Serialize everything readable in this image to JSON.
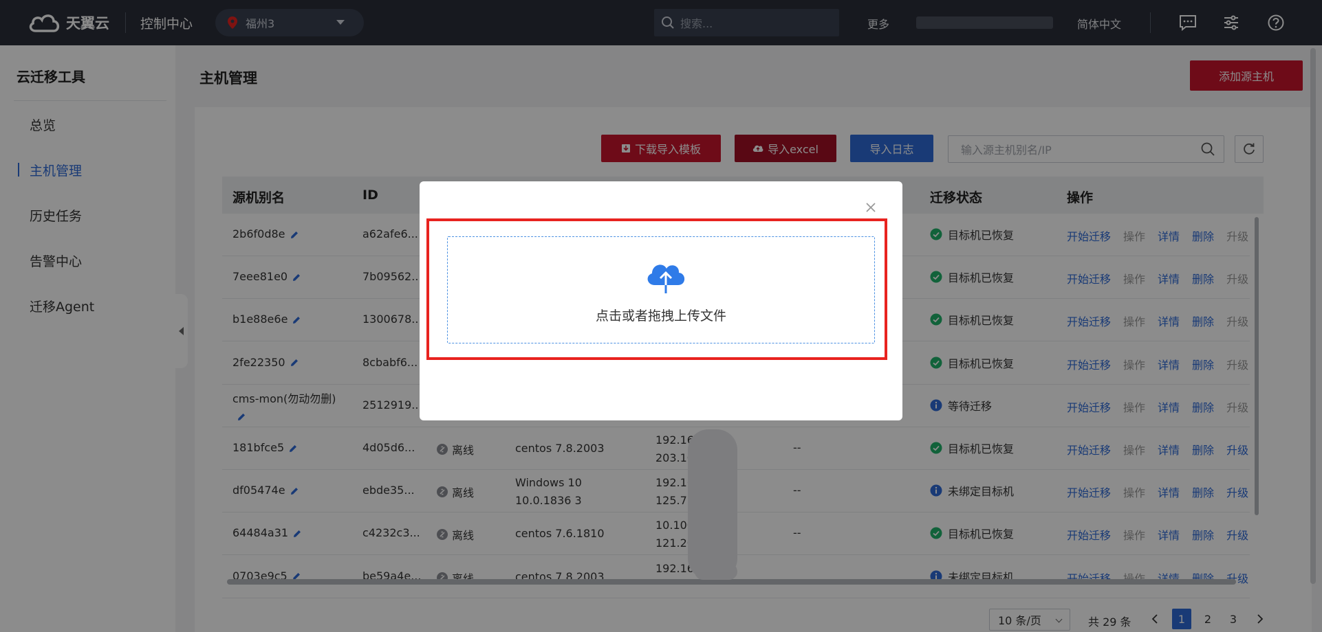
{
  "topbar": {
    "brand": "天翼云",
    "console": "控制中心",
    "region": "福州3",
    "search_placeholder": "搜索...",
    "more": "更多",
    "language": "简体中文"
  },
  "sidebar": {
    "title": "云迁移工具",
    "items": [
      {
        "label": "总览"
      },
      {
        "label": "主机管理"
      },
      {
        "label": "历史任务"
      },
      {
        "label": "告警中心"
      },
      {
        "label": "迁移Agent"
      }
    ]
  },
  "main": {
    "title": "主机管理",
    "add_button": "添加源主机",
    "toolbar": {
      "download_template": "下载导入模板",
      "import_excel": "导入excel",
      "import_log": "导入日志",
      "search_placeholder": "输入源主机别名/IP"
    },
    "table": {
      "headers": {
        "alias": "源机别名",
        "id": "ID",
        "status": "迁移状态",
        "ops": "操作"
      },
      "ops_labels": {
        "start": "开始迁移",
        "operate": "操作",
        "detail": "详情",
        "delete": "删除",
        "upgrade": "升级"
      },
      "rows": [
        {
          "alias": "2b6f0d8e",
          "id": "a62afe6...",
          "conn": "",
          "os": "",
          "ip1": "",
          "ip2": "",
          "dash": "",
          "status": "目标机已恢复",
          "status_type": "ok"
        },
        {
          "alias": "7eee81e0",
          "id": "7b09562...",
          "conn": "",
          "os": "",
          "ip1": "",
          "ip2": "",
          "dash": "",
          "status": "目标机已恢复",
          "status_type": "ok"
        },
        {
          "alias": "b1e88e6e",
          "id": "1300678...",
          "conn": "",
          "os": "",
          "ip1": "",
          "ip2": "",
          "dash": "",
          "status": "目标机已恢复",
          "status_type": "ok"
        },
        {
          "alias": "2fe22350",
          "id": "8cbabf6...",
          "conn": "",
          "os": "",
          "ip1": "",
          "ip2": "",
          "dash": "",
          "status": "目标机已恢复",
          "status_type": "ok"
        },
        {
          "alias": "cms-mon(勿动勿删)",
          "id": "2512919...",
          "conn": "",
          "os": "",
          "ip1": "",
          "ip2": "",
          "dash": "",
          "status": "等待迁移",
          "status_type": "info"
        },
        {
          "alias": "181bfce5",
          "id": "4d05d6...",
          "conn": "离线",
          "os": "centos 7.8.2003",
          "ip1": "192.168",
          "ip2": "203.104",
          "dash": "--",
          "status": "目标机已恢复",
          "status_type": "ok"
        },
        {
          "alias": "df05474e",
          "id": "ebde35...",
          "conn": "离线",
          "os": "Windows 10 10.0.1836 3",
          "ip1": "192.168",
          "ip2": "125.77.5",
          "dash": "--",
          "status": "未绑定目标机",
          "status_type": "info"
        },
        {
          "alias": "64484a31",
          "id": "c4232c3...",
          "conn": "离线",
          "os": "centos 7.6.1810",
          "ip1": "10.100",
          "ip2": "121.20",
          "dash": "--",
          "status": "目标机已恢复",
          "status_type": "ok"
        },
        {
          "alias": "0703e9c5",
          "id": "be59a4e...",
          "conn": "离线",
          "os": "centos 7.8.2003",
          "ip1": "192.16",
          "ip2": "",
          "dash": "",
          "status": "未绑定目标机",
          "status_type": "info"
        }
      ]
    },
    "pagination": {
      "page_size": "10 条/页",
      "total": "共 29 条",
      "pages": [
        "1",
        "2",
        "3"
      ],
      "current": "1"
    }
  },
  "modal": {
    "upload_text": "点击或者拖拽上传文件"
  },
  "colors": {
    "topbar_bg": "#2b2f3a",
    "brand_red": "#c9142d",
    "primary_blue": "#2f6bd8",
    "success_green": "#1fb36a",
    "highlight_red": "#e8231f"
  }
}
